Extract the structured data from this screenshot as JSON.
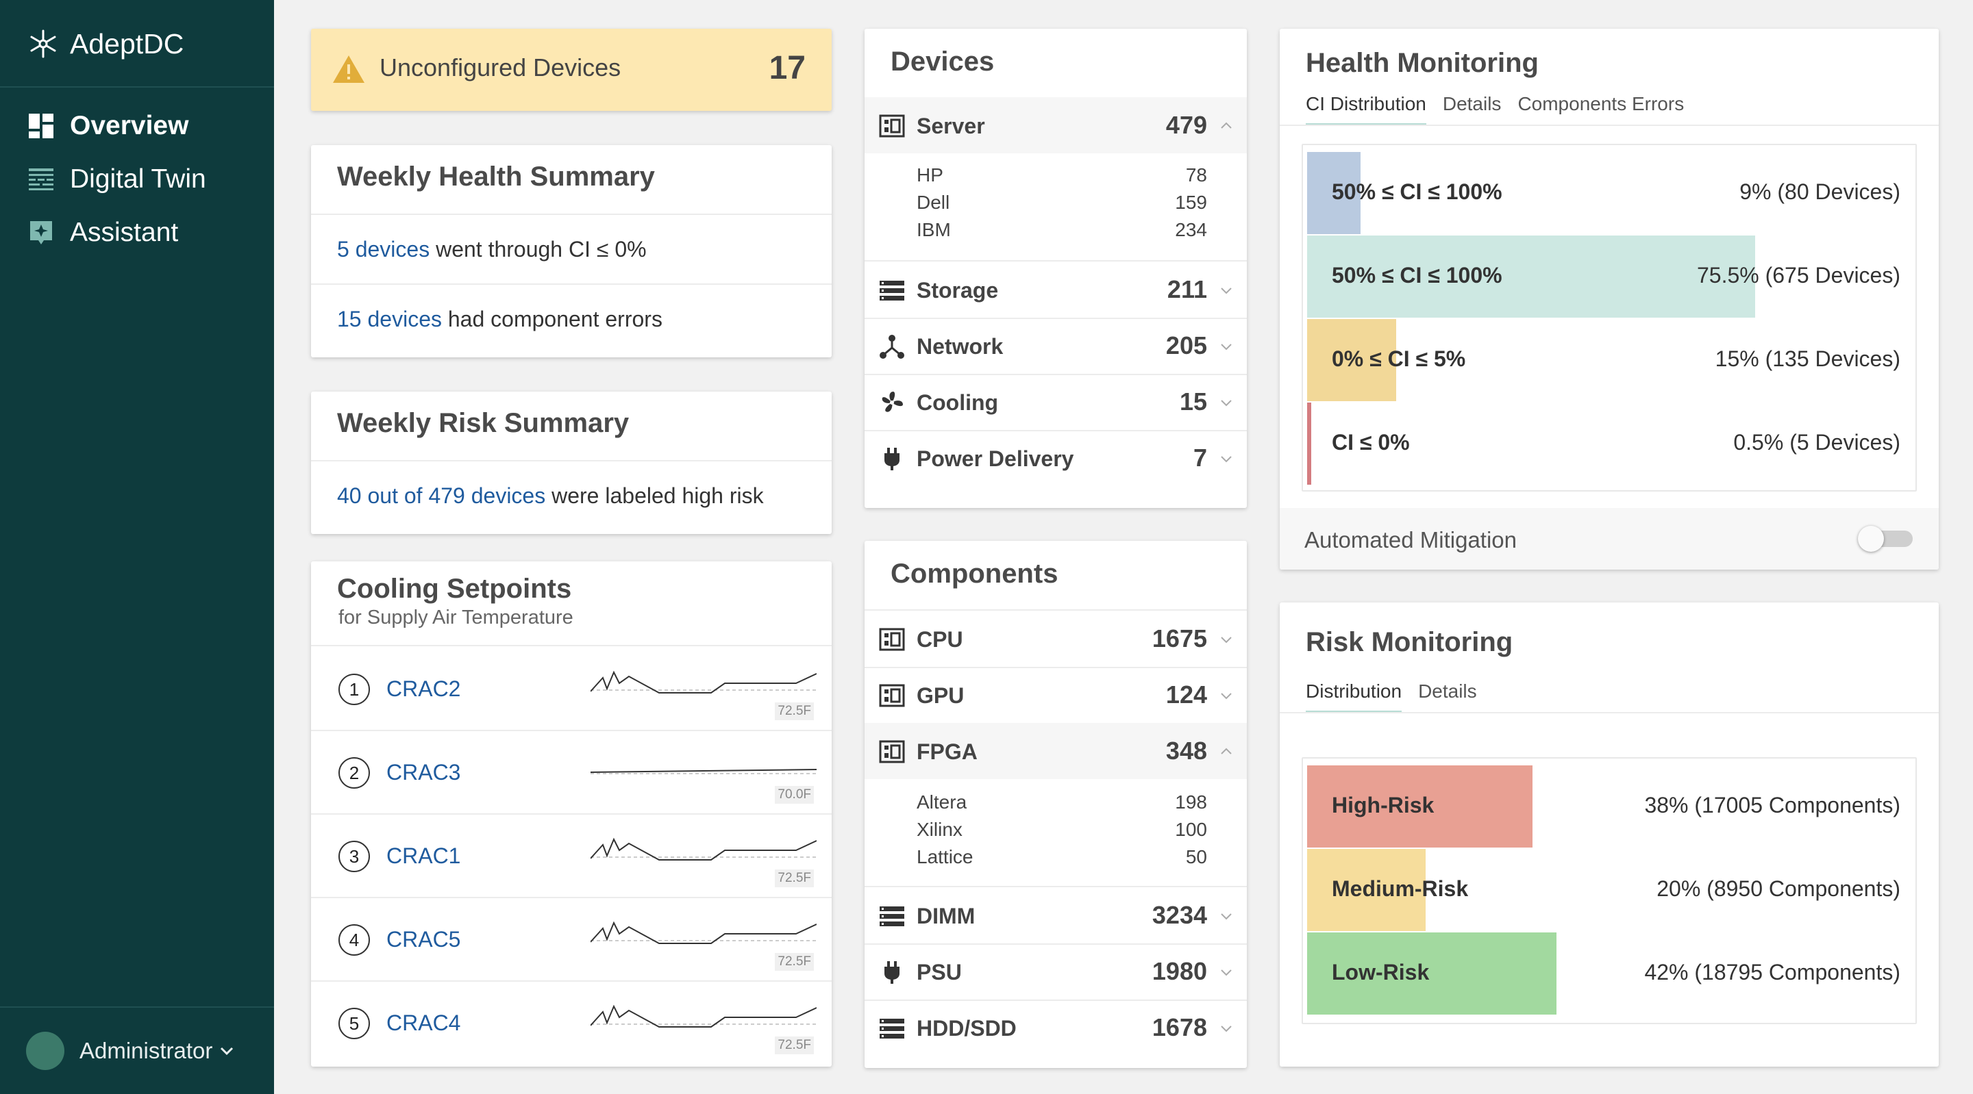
{
  "brand": {
    "name": "AdeptDC"
  },
  "nav": [
    {
      "label": "Overview",
      "icon": "dashboard-icon",
      "active": true
    },
    {
      "label": "Digital Twin",
      "icon": "digital-twin-icon",
      "active": false
    },
    {
      "label": "Assistant",
      "icon": "assistant-icon",
      "active": false
    }
  ],
  "user": {
    "name": "Administrator"
  },
  "unconfigured": {
    "label": "Unconfigured Devices",
    "count": "17",
    "icon": "warning-icon"
  },
  "health_summary": {
    "title": "Weekly Health Summary",
    "items": [
      {
        "link": "5 devices",
        "text": " went through CI ≤ 0%"
      },
      {
        "link": "15 devices",
        "text": " had component errors"
      }
    ]
  },
  "risk_summary": {
    "title": "Weekly Risk Summary",
    "items": [
      {
        "link": "40 out of 479 devices",
        "text": " were labeled high risk"
      }
    ]
  },
  "cooling": {
    "title": "Cooling Setpoints",
    "subtitle": "for Supply Air Temperature",
    "items": [
      {
        "num": "1",
        "name": "CRAC2",
        "temp": "72.5F"
      },
      {
        "num": "2",
        "name": "CRAC3",
        "temp": "70.0F"
      },
      {
        "num": "3",
        "name": "CRAC1",
        "temp": "72.5F"
      },
      {
        "num": "4",
        "name": "CRAC5",
        "temp": "72.5F"
      },
      {
        "num": "5",
        "name": "CRAC4",
        "temp": "72.5F"
      }
    ]
  },
  "devices": {
    "title": "Devices",
    "items": [
      {
        "name": "Server",
        "count": "479",
        "icon": "chip-icon",
        "expanded": true,
        "children": [
          {
            "name": "HP",
            "value": "78"
          },
          {
            "name": "Dell",
            "value": "159"
          },
          {
            "name": "IBM",
            "value": "234"
          }
        ]
      },
      {
        "name": "Storage",
        "count": "211",
        "icon": "storage-icon"
      },
      {
        "name": "Network",
        "count": "205",
        "icon": "network-icon"
      },
      {
        "name": "Cooling",
        "count": "15",
        "icon": "fan-icon"
      },
      {
        "name": "Power Delivery",
        "count": "7",
        "icon": "plug-icon"
      }
    ]
  },
  "components": {
    "title": "Components",
    "items": [
      {
        "name": "CPU",
        "count": "1675",
        "icon": "chip-icon"
      },
      {
        "name": "GPU",
        "count": "124",
        "icon": "chip-icon"
      },
      {
        "name": "FPGA",
        "count": "348",
        "icon": "chip-icon",
        "expanded": true,
        "children": [
          {
            "name": "Altera",
            "value": "198"
          },
          {
            "name": "Xilinx",
            "value": "100"
          },
          {
            "name": "Lattice",
            "value": "50"
          }
        ]
      },
      {
        "name": "DIMM",
        "count": "3234",
        "icon": "storage-icon"
      },
      {
        "name": "PSU",
        "count": "1980",
        "icon": "plug-icon"
      },
      {
        "name": "HDD/SDD",
        "count": "1678",
        "icon": "storage-icon"
      }
    ]
  },
  "health_monitoring": {
    "title": "Health Monitoring",
    "tabs": [
      {
        "label": "CI Distribution",
        "active": true
      },
      {
        "label": "Details"
      },
      {
        "label": "Components Errors"
      }
    ],
    "bars": [
      {
        "label": "50% ≤ CI ≤ 100%",
        "value": "9% (80 Devices)",
        "fraction": 0.09,
        "color": "#b9cae0"
      },
      {
        "label": "50% ≤ CI ≤ 100%",
        "value": "75.5% (675 Devices)",
        "fraction": 0.755,
        "color": "#cde8e2"
      },
      {
        "label": "0% ≤ CI ≤ 5%",
        "value": "15% (135 Devices)",
        "fraction": 0.15,
        "color": "#f2d898"
      },
      {
        "label": "CI ≤ 0%",
        "value": "0.5% (5 Devices)",
        "fraction": 0.005,
        "color": "#d47c80"
      }
    ],
    "mitigation": {
      "label": "Automated Mitigation",
      "enabled": false
    }
  },
  "risk_monitoring": {
    "title": "Risk Monitoring",
    "tabs": [
      {
        "label": "Distribution",
        "active": true
      },
      {
        "label": "Details"
      }
    ],
    "bars": [
      {
        "label": "High-Risk",
        "value": "38% (17005 Components)",
        "fraction": 0.38,
        "color": "#e8a093"
      },
      {
        "label": "Medium-Risk",
        "value": "20% (8950 Components)",
        "fraction": 0.2,
        "color": "#f6dd9c"
      },
      {
        "label": "Low-Risk",
        "value": "42% (18795 Components)",
        "fraction": 0.42,
        "color": "#a2d99f"
      }
    ]
  }
}
